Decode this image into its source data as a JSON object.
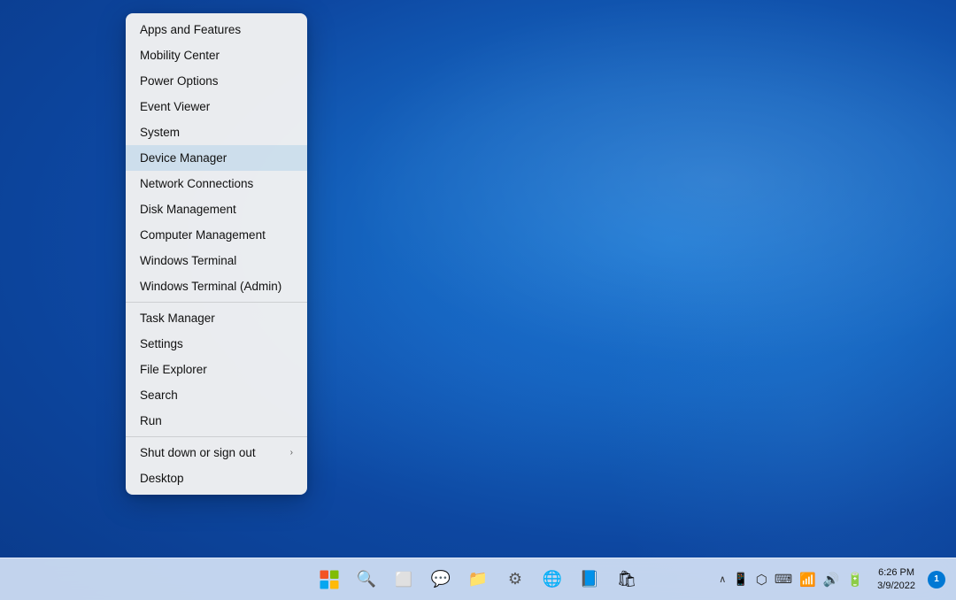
{
  "desktop": {
    "background_color": "#1565c0"
  },
  "context_menu": {
    "items": [
      {
        "id": "apps-features",
        "label": "Apps and Features",
        "separator_after": false
      },
      {
        "id": "mobility-center",
        "label": "Mobility Center",
        "separator_after": false
      },
      {
        "id": "power-options",
        "label": "Power Options",
        "separator_after": false
      },
      {
        "id": "event-viewer",
        "label": "Event Viewer",
        "separator_after": false
      },
      {
        "id": "system",
        "label": "System",
        "separator_after": false
      },
      {
        "id": "device-manager",
        "label": "Device Manager",
        "separator_after": false,
        "highlighted": true
      },
      {
        "id": "network-connections",
        "label": "Network Connections",
        "separator_after": false
      },
      {
        "id": "disk-management",
        "label": "Disk Management",
        "separator_after": false
      },
      {
        "id": "computer-management",
        "label": "Computer Management",
        "separator_after": false
      },
      {
        "id": "windows-terminal",
        "label": "Windows Terminal",
        "separator_after": false
      },
      {
        "id": "windows-terminal-admin",
        "label": "Windows Terminal (Admin)",
        "separator_after": true
      },
      {
        "id": "task-manager",
        "label": "Task Manager",
        "separator_after": false
      },
      {
        "id": "settings",
        "label": "Settings",
        "separator_after": false
      },
      {
        "id": "file-explorer",
        "label": "File Explorer",
        "separator_after": false
      },
      {
        "id": "search",
        "label": "Search",
        "separator_after": false
      },
      {
        "id": "run",
        "label": "Run",
        "separator_after": true
      },
      {
        "id": "shut-down",
        "label": "Shut down or sign out",
        "has_submenu": true,
        "separator_after": false
      },
      {
        "id": "desktop",
        "label": "Desktop",
        "separator_after": false
      }
    ]
  },
  "taskbar": {
    "apps": [
      {
        "id": "start",
        "label": "Start",
        "icon": "⊞"
      },
      {
        "id": "search",
        "label": "Search",
        "icon": "🔍"
      },
      {
        "id": "taskview",
        "label": "Task View",
        "icon": "⧉"
      },
      {
        "id": "teams-chat",
        "label": "Microsoft Teams Chat",
        "icon": "💬"
      },
      {
        "id": "file-explorer",
        "label": "File Explorer",
        "icon": "📁"
      },
      {
        "id": "settings-gear",
        "label": "Settings",
        "icon": "⚙"
      },
      {
        "id": "edge",
        "label": "Microsoft Edge",
        "icon": "🌐"
      },
      {
        "id": "sway",
        "label": "Microsoft Sway",
        "icon": "📘"
      },
      {
        "id": "store",
        "label": "Microsoft Store",
        "icon": "🛍"
      }
    ],
    "tray": {
      "chevron": "∧",
      "phone_link": "📱",
      "bluetooth": "⬡",
      "keyboard": "⌨",
      "wifi": "📶",
      "volume": "🔊",
      "battery": "🔋",
      "time": "6:26 PM",
      "date": "3/9/2022",
      "notification_count": "1"
    }
  }
}
